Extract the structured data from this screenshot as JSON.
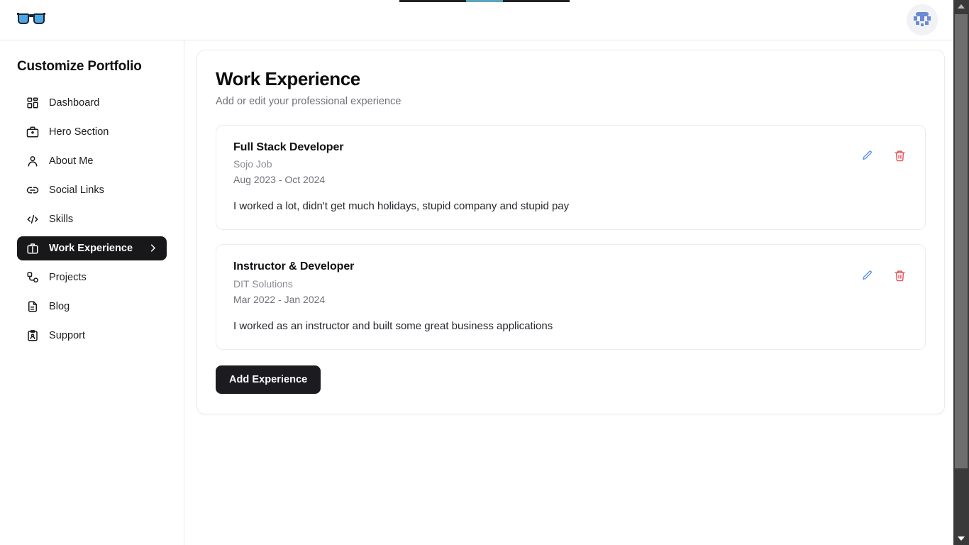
{
  "browser": {
    "tab_strip_present": true
  },
  "header": {
    "logo_icon": "sunglasses-logo-icon",
    "avatar_icon": "user-avatar-identicon"
  },
  "sidebar": {
    "title": "Customize Portfolio",
    "items": [
      {
        "label": "Dashboard",
        "icon": "grid-dashboard-icon",
        "active": false
      },
      {
        "label": "Hero Section",
        "icon": "briefcase-icon",
        "active": false
      },
      {
        "label": "About Me",
        "icon": "user-icon",
        "active": false
      },
      {
        "label": "Social Links",
        "icon": "link-icon",
        "active": false
      },
      {
        "label": "Skills",
        "icon": "code-brackets-icon",
        "active": false
      },
      {
        "label": "Work Experience",
        "icon": "suitcase-icon",
        "active": true
      },
      {
        "label": "Projects",
        "icon": "workflow-nodes-icon",
        "active": false
      },
      {
        "label": "Blog",
        "icon": "document-text-icon",
        "active": false
      },
      {
        "label": "Support",
        "icon": "contact-card-icon",
        "active": false
      }
    ],
    "active_chevron_icon": "chevron-right-icon"
  },
  "main": {
    "title": "Work Experience",
    "subtitle": "Add or edit your professional experience",
    "experiences": [
      {
        "role": "Full Stack Developer",
        "company": "Sojo Job",
        "dates": "Aug 2023 - Oct 2024",
        "description": "I worked a lot, didn't get much holidays, stupid company and stupid pay",
        "edit_icon": "pencil-edit-icon",
        "delete_icon": "trash-delete-icon"
      },
      {
        "role": "Instructor & Developer",
        "company": "DIT Solutions",
        "dates": "Mar 2022 - Jan 2024",
        "description": "I worked as an instructor and built some great business applications",
        "edit_icon": "pencil-edit-icon",
        "delete_icon": "trash-delete-icon"
      }
    ],
    "add_button_label": "Add Experience"
  },
  "colors": {
    "accent_dark": "#18181b",
    "edit_blue": "#6195e8",
    "delete_red": "#e8525c",
    "muted_text": "#71717a",
    "border": "#ececef",
    "logo_blue": "#4aa8e8"
  },
  "scrollbar": {
    "up_arrow_icon": "scroll-up-arrow-icon",
    "down_arrow_icon": "scroll-down-arrow-icon"
  }
}
